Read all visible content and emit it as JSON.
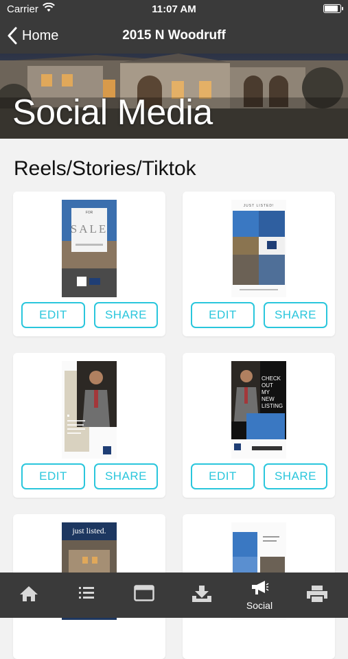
{
  "status_bar": {
    "carrier": "Carrier",
    "time": "11:07 AM"
  },
  "nav": {
    "back_label": "Home",
    "title": "2015 N Woodruff"
  },
  "hero": {
    "title": "Social Media"
  },
  "section": {
    "title": "Reels/Stories/Tiktok"
  },
  "cards": [
    {
      "edit": "EDIT",
      "share": "SHARE",
      "thumb_text": [
        "FOR",
        "SALE"
      ]
    },
    {
      "edit": "EDIT",
      "share": "SHARE",
      "thumb_text": [
        "JUST LISTED!"
      ]
    },
    {
      "edit": "EDIT",
      "share": "SHARE"
    },
    {
      "edit": "EDIT",
      "share": "SHARE",
      "thumb_text": [
        "CHECK",
        "OUT",
        "MY",
        "NEW",
        "LISTING"
      ]
    },
    {
      "thumb_text": [
        "just listed."
      ]
    },
    {}
  ],
  "tabs": [
    {
      "icon": "home-icon"
    },
    {
      "icon": "list-icon"
    },
    {
      "icon": "browser-icon"
    },
    {
      "icon": "download-icon"
    },
    {
      "icon": "megaphone-icon",
      "label": "Social"
    },
    {
      "icon": "printer-icon"
    }
  ],
  "colors": {
    "bar": "#3a3a3a",
    "accent": "#29c6dc",
    "background": "#f2f2f2"
  }
}
